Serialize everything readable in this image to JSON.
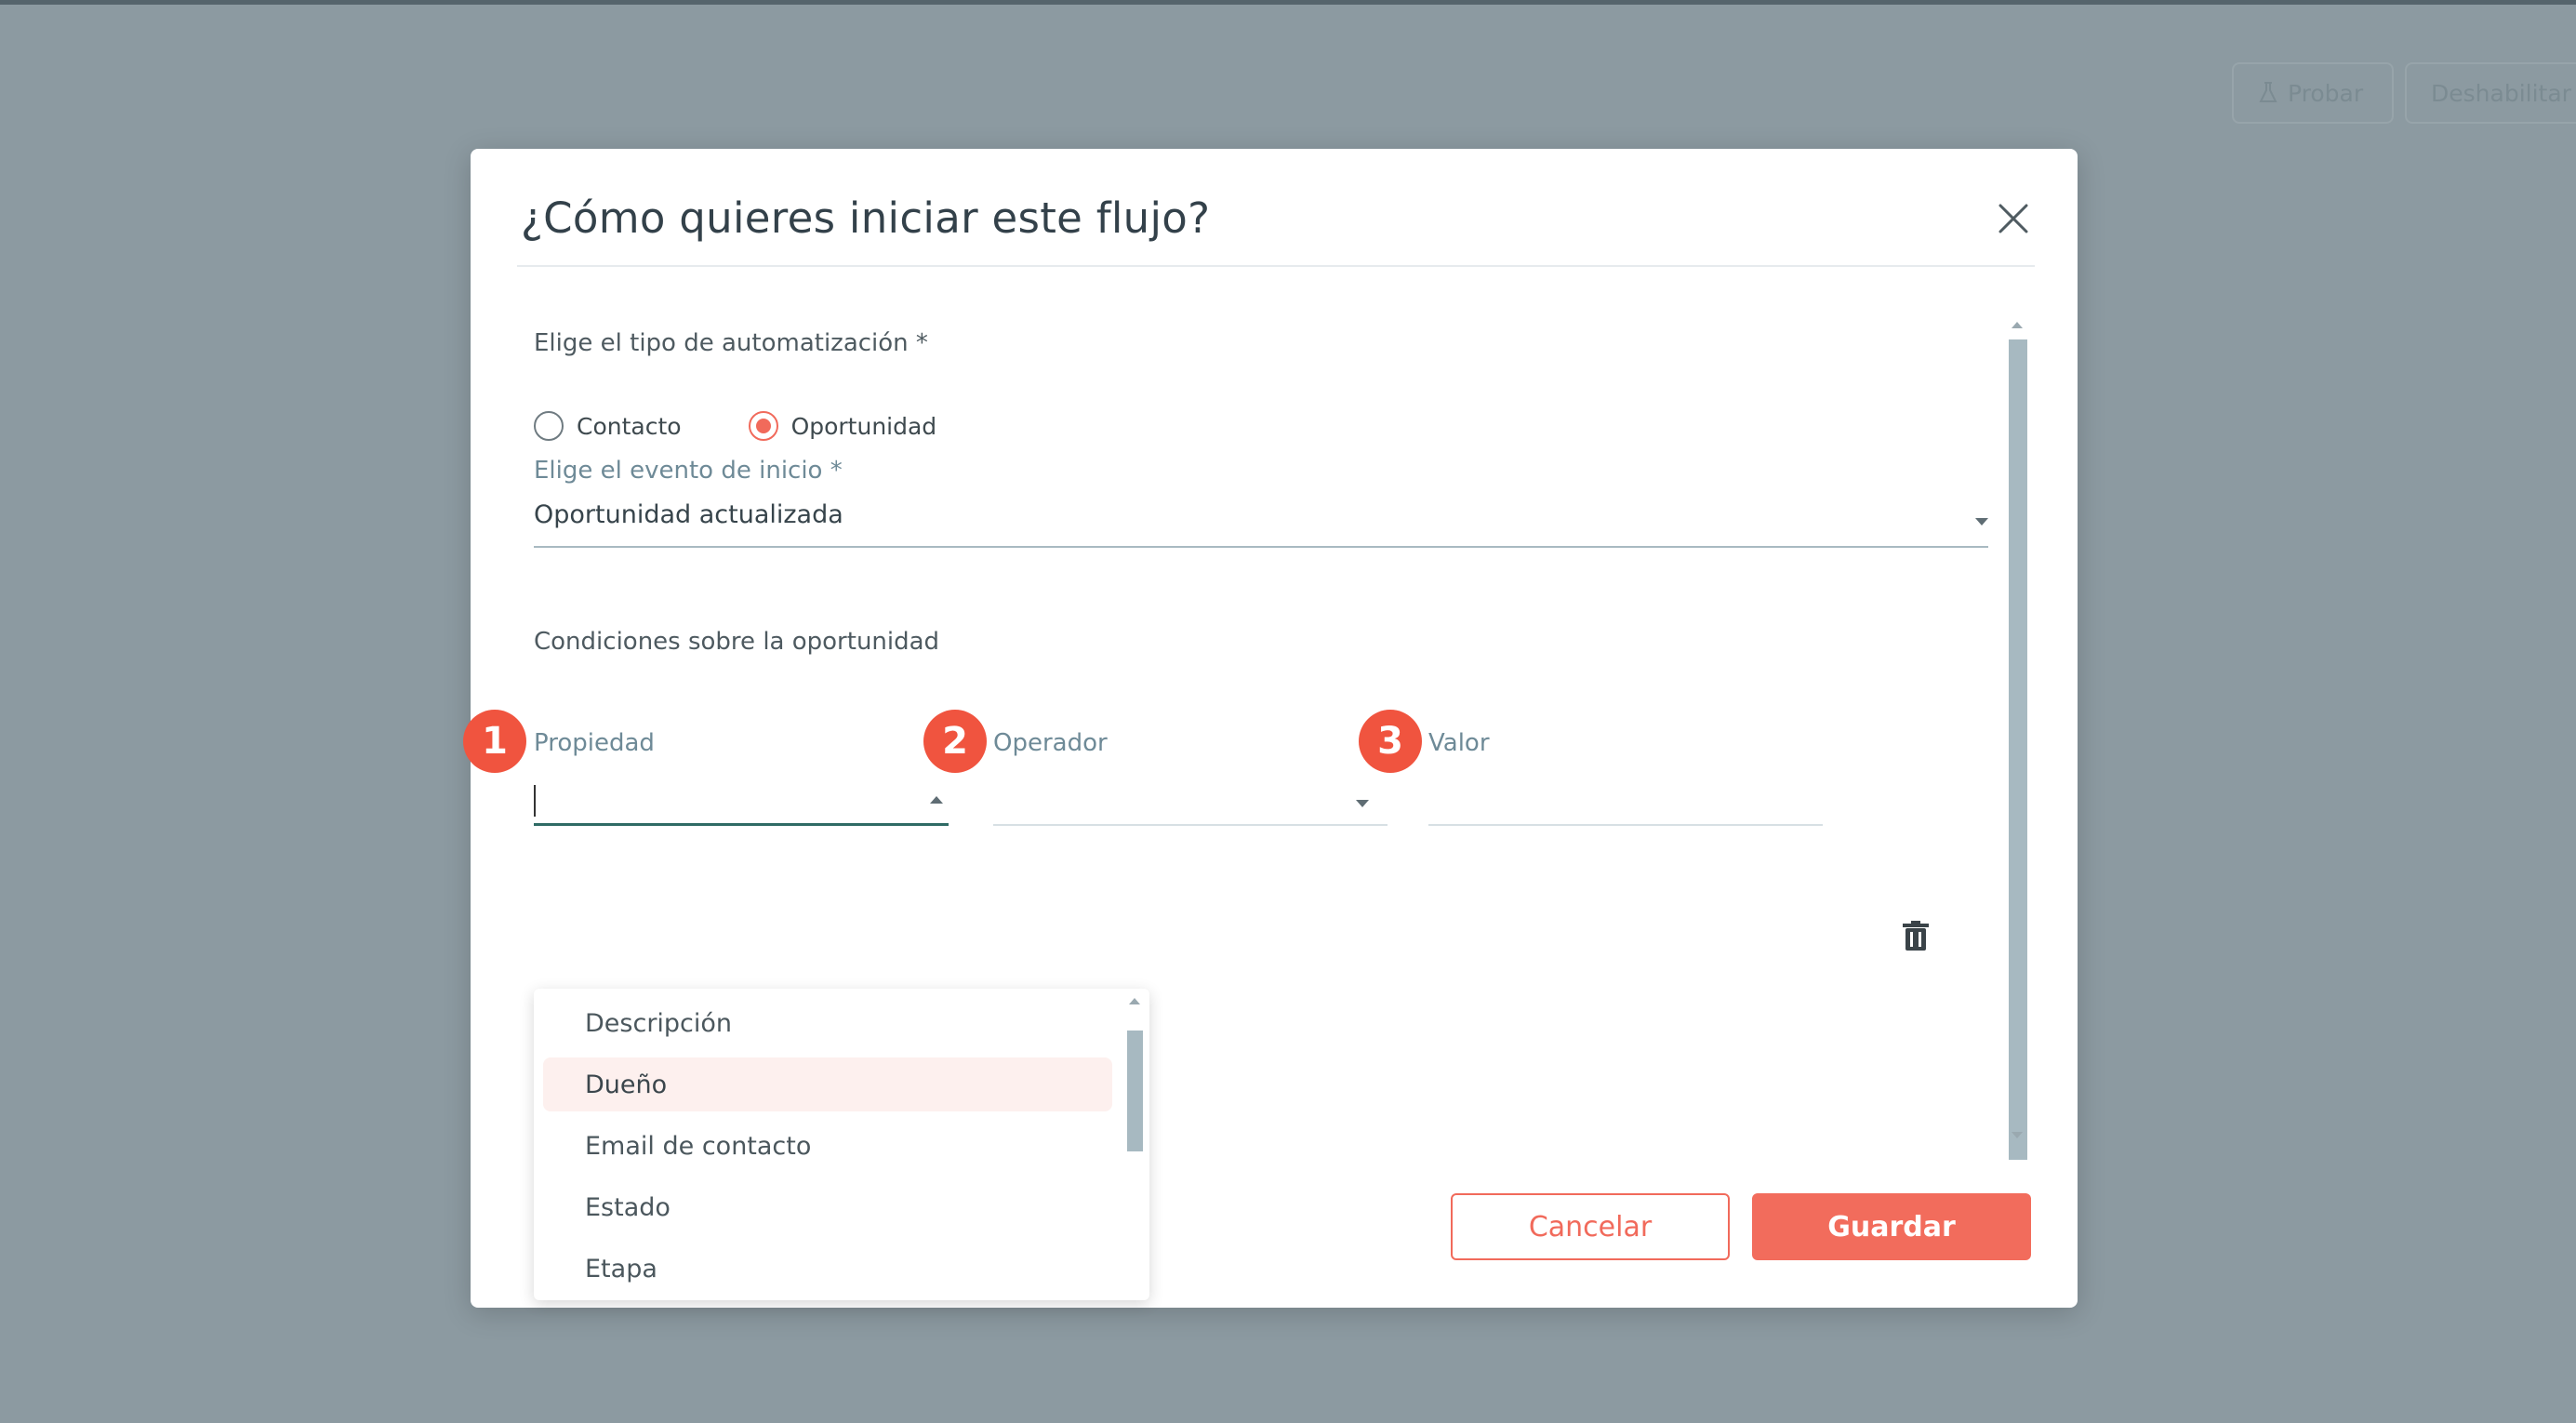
{
  "background": {
    "buttons": [
      {
        "label": "Probar",
        "icon": "flask-icon"
      },
      {
        "label": "Deshabilitar"
      }
    ]
  },
  "modal": {
    "title": "¿Cómo quieres iniciar este flujo?",
    "automation_type": {
      "label": "Elige el tipo de automatización *",
      "options": [
        {
          "label": "Contacto",
          "checked": false
        },
        {
          "label": "Oportunidad",
          "checked": true
        }
      ]
    },
    "start_event": {
      "label": "Elige el evento de inicio *",
      "value": "Oportunidad actualizada"
    },
    "conditions": {
      "heading": "Condiciones sobre la oportunidad",
      "fields": {
        "property_label": "Propiedad",
        "operator_label": "Operador",
        "value_label": "Valor"
      },
      "badges": [
        "1",
        "2",
        "3"
      ],
      "dropdown_options": [
        "Descripción",
        "Dueño",
        "Email de contacto",
        "Estado",
        "Etapa"
      ],
      "highlighted_option": "Dueño"
    },
    "buttons": {
      "cancel": "Cancelar",
      "save": "Guardar"
    }
  },
  "colors": {
    "accent": "#f26c5c",
    "badge": "#f0543f",
    "overlay": "#8c9aa1",
    "active_underline": "#2f6b65"
  }
}
